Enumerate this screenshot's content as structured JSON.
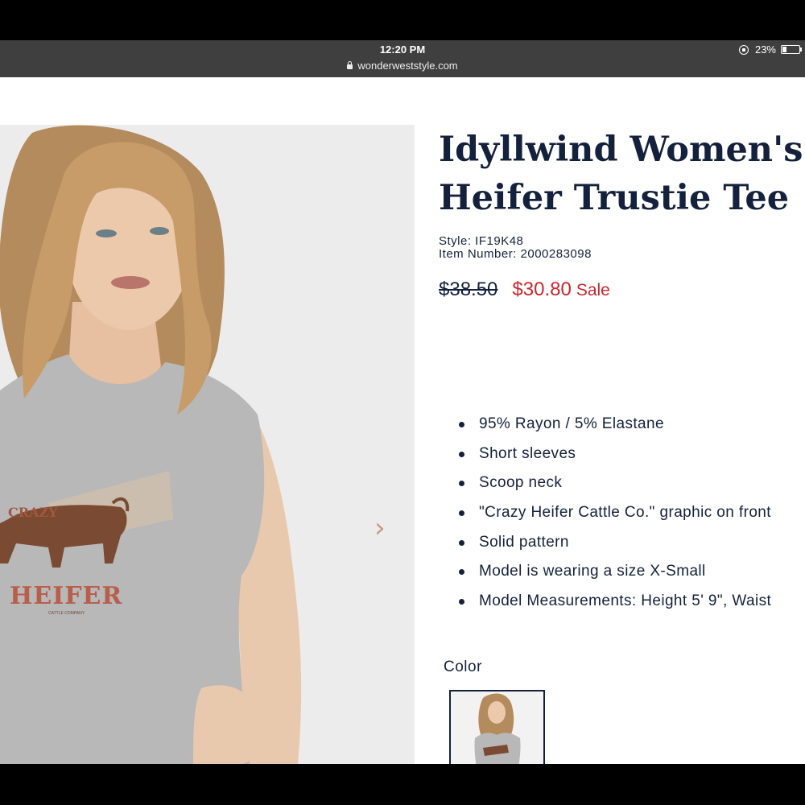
{
  "status_bar": {
    "time": "12:20 PM",
    "battery": "23%",
    "battery_level": 0.23
  },
  "browser": {
    "url": "wonderweststyle.com"
  },
  "product": {
    "title_line1": "Idyllwind Women's",
    "title_line2": "Heifer Trustie Tee",
    "style": "Style: IF19K48",
    "item_number": "Item Number: 2000283098",
    "original_price": "$38.50",
    "sale_price": "$30.80",
    "sale_label": "Sale",
    "features": [
      "95% Rayon / 5% Elastane",
      "Short sleeves",
      "Scoop neck",
      "\"Crazy Heifer Cattle Co.\" graphic on front",
      "Solid pattern",
      "Model is wearing a size X-Small",
      "Model Measurements: Height 5' 9\", Waist"
    ],
    "color_label": "Color",
    "shirt_graphic": {
      "line1": "CRAZY",
      "line2": "HEIFER",
      "line3": "CATTLE COMPANY"
    }
  },
  "colors": {
    "navy": "#14213d",
    "sale_red": "#c8262d",
    "arrow": "#c69a7d"
  },
  "icons": {
    "next": "chevron-right-icon",
    "lock": "lock-icon",
    "rotation": "rotation-lock-icon",
    "battery": "battery-icon"
  }
}
